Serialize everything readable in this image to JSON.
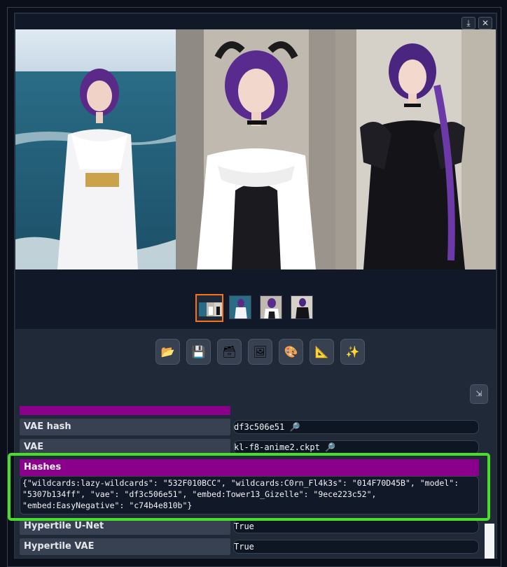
{
  "gallery": {
    "download_icon": "download-icon",
    "close_icon": "close-icon",
    "thumbnail_count": 4,
    "selected_thumbnail": 1
  },
  "toolbar": {
    "buttons": [
      {
        "name": "open-folder",
        "icon": "📂"
      },
      {
        "name": "save",
        "icon": "💾"
      },
      {
        "name": "zip",
        "icon": "🗃"
      },
      {
        "name": "send-to-img2img",
        "icon": "🖼"
      },
      {
        "name": "send-to-inpaint",
        "icon": "🎨"
      },
      {
        "name": "send-to-extras",
        "icon": "📐"
      },
      {
        "name": "send-to-magic",
        "icon": "✨"
      }
    ]
  },
  "info_table": {
    "rows": [
      {
        "key": "VAE hash",
        "value": "df3c506e51 🔎"
      },
      {
        "key": "VAE",
        "value": "kl-f8-anime2.ckpt 🔎"
      }
    ],
    "hashes": {
      "key": "Hashes",
      "value": "{\"wildcards:lazy-wildcards\": \"532F010BCC\", \"wildcards:C0rn_Fl4k3s\": \"014F70D45B\", \"model\": \"5307b134ff\", \"vae\": \"df3c506e51\", \"embed:Tower13_Gizelle\": \"9ece223c52\", \"embed:EasyNegative\": \"c74b4e810b\"}"
    },
    "rows_after": [
      {
        "key": "Hypertile U-Net",
        "value": "True"
      },
      {
        "key": "Hypertile VAE",
        "value": "True"
      }
    ]
  },
  "colors": {
    "highlight": "#4ade2a",
    "hashes_header": "#8b008b",
    "selected_thumb": "#f97316"
  }
}
